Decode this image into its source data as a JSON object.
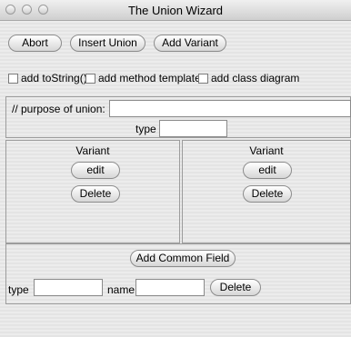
{
  "window": {
    "title": "The Union Wizard"
  },
  "toolbar": {
    "abort": "Abort",
    "insert_union": "Insert Union",
    "add_variant": "Add Variant"
  },
  "options": {
    "to_string": "add toString()",
    "method_template": "add method template",
    "class_diagram": "add class diagram"
  },
  "union": {
    "purpose_label": "// purpose of union:",
    "purpose_value": "",
    "type_label": "type",
    "type_value": ""
  },
  "variants": [
    {
      "title": "Variant",
      "edit": "edit",
      "delete": "Delete"
    },
    {
      "title": "Variant",
      "edit": "edit",
      "delete": "Delete"
    }
  ],
  "common": {
    "add_button": "Add Common Field",
    "type_label": "type",
    "type_value": "",
    "name_label": "name",
    "name_value": "",
    "delete_button": "Delete"
  }
}
